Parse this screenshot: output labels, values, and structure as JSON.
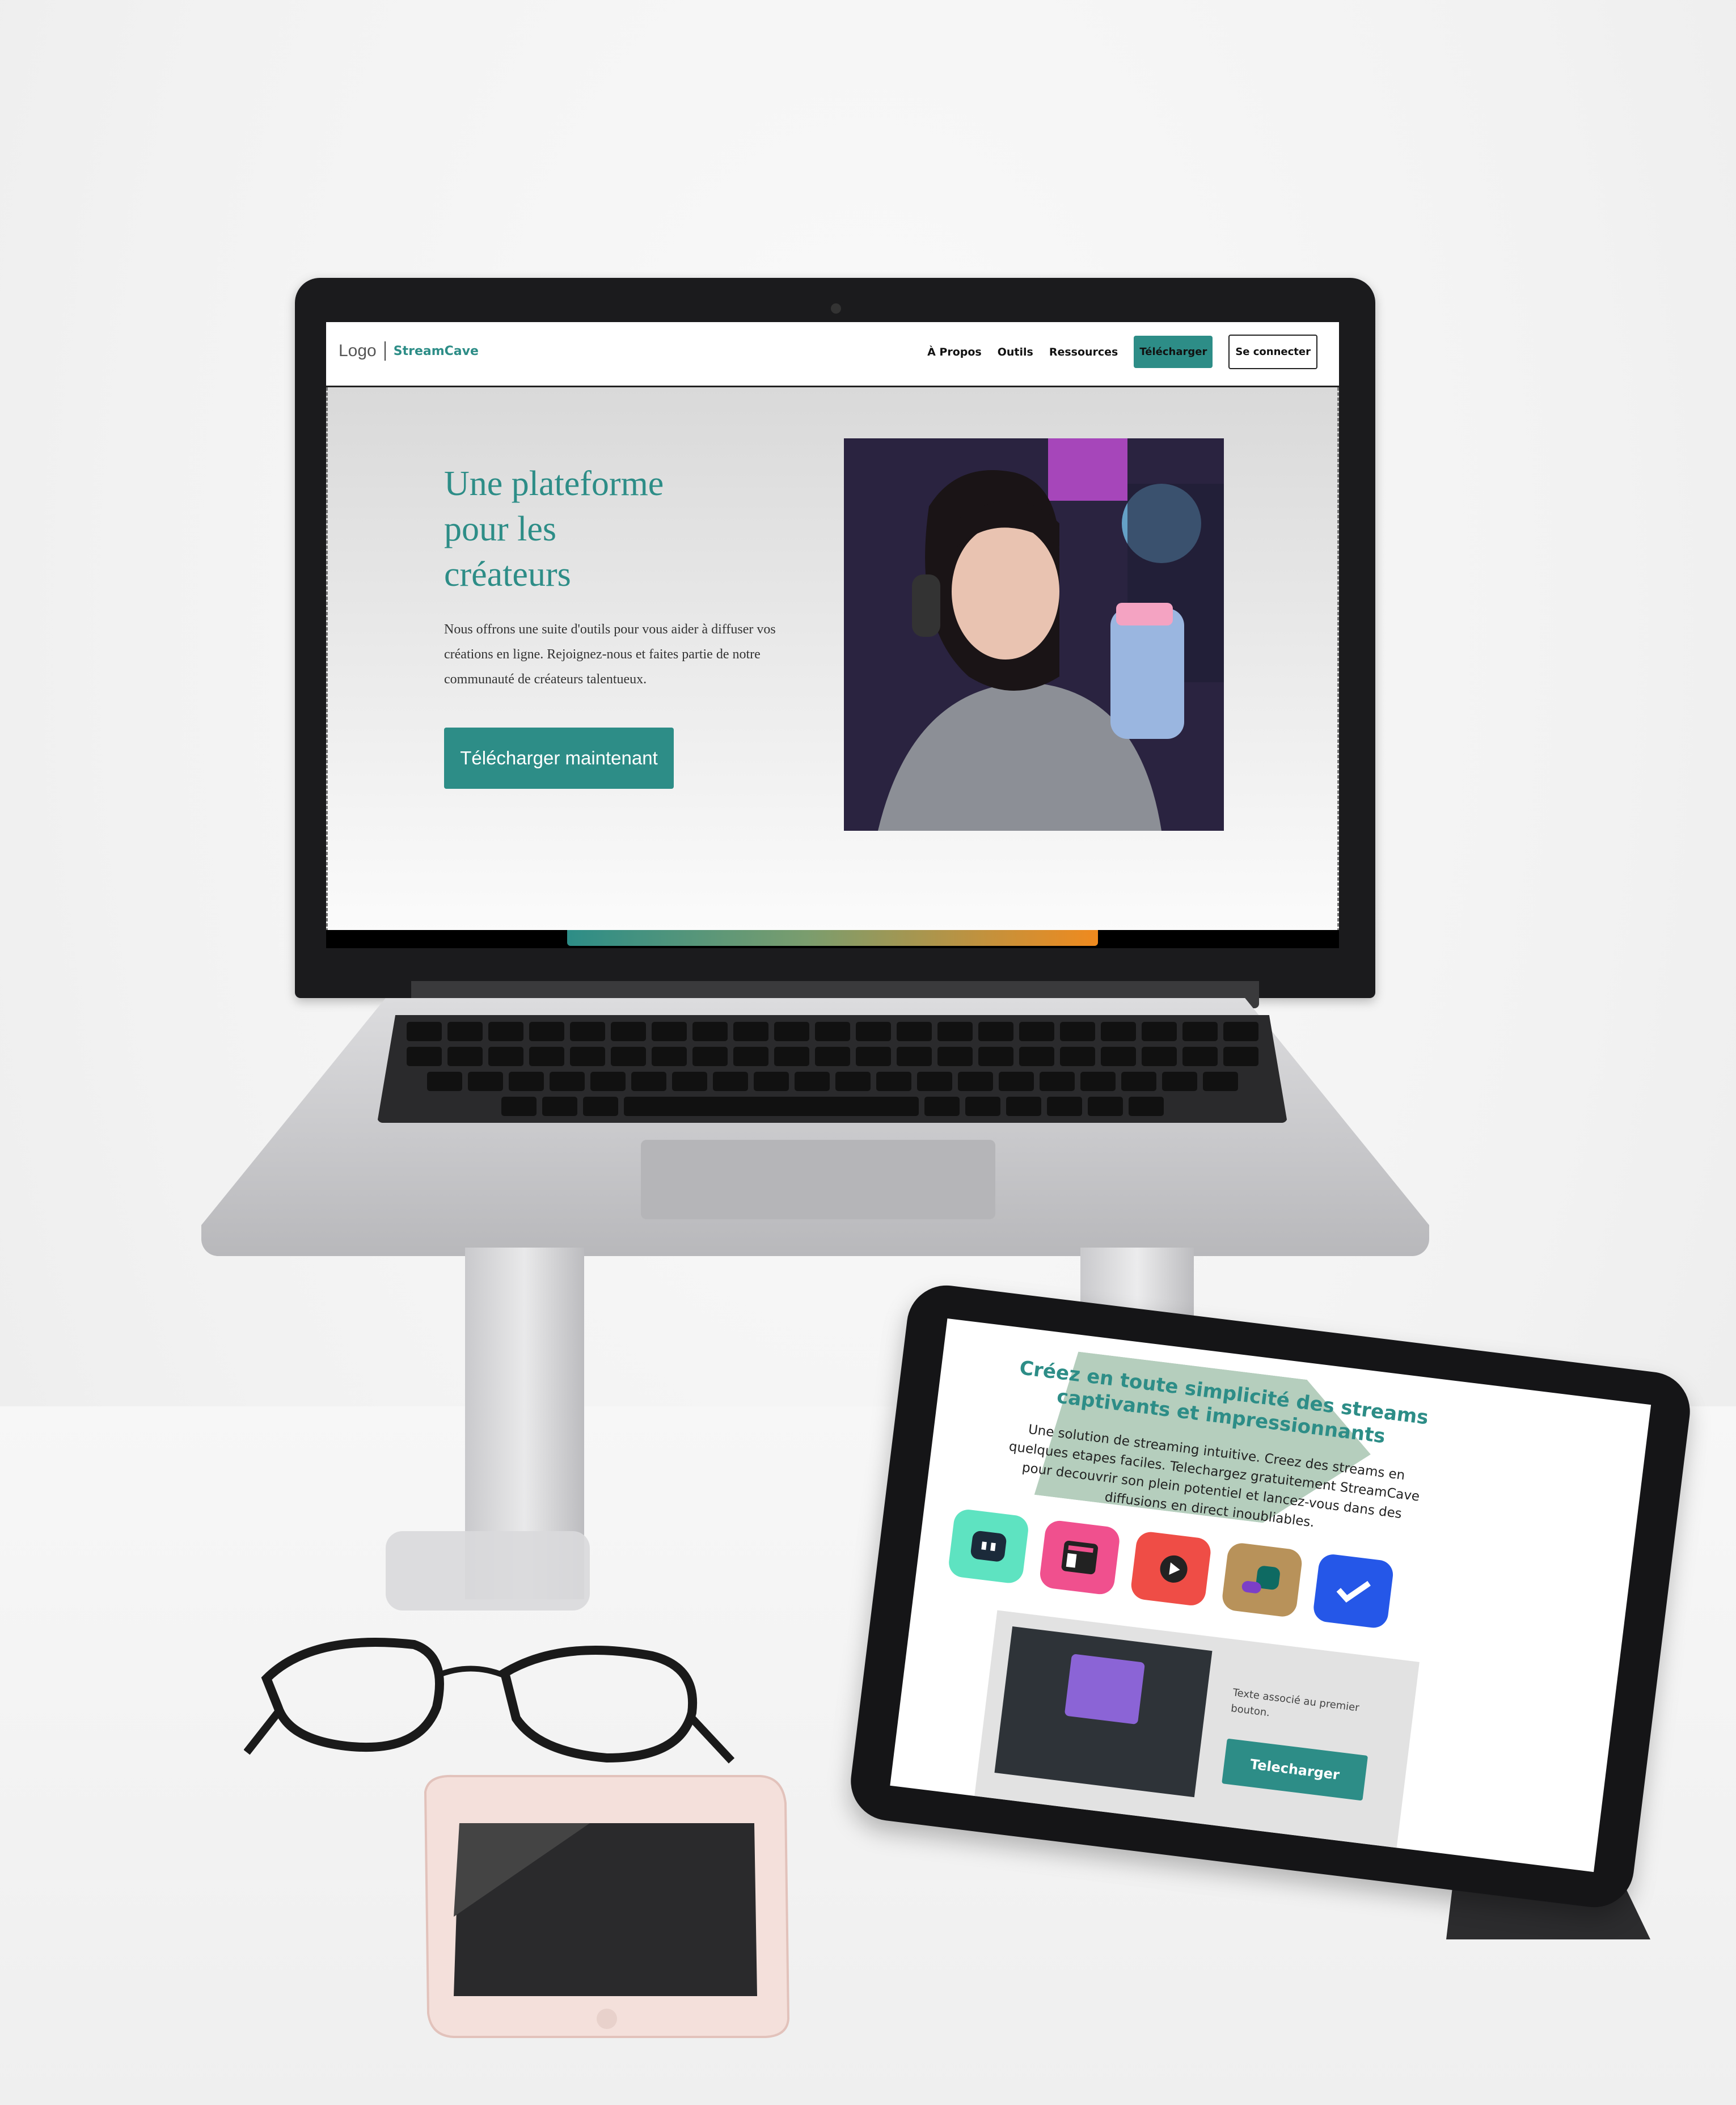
{
  "website": {
    "nav": {
      "logo_alt": "Logo",
      "brand": "StreamCave",
      "links": [
        "À Propos",
        "Outils",
        "Ressources"
      ],
      "download_button": "Télécharger",
      "login_button": "Se connecter"
    },
    "hero": {
      "title_lines": [
        "Une plateforme",
        "pour les",
        "créateurs"
      ],
      "description": "Nous offrons une suite d'outils pour vous aider à diffuser vos créations en ligne. Rejoignez-nous et faites partie de notre communauté de créateurs talentueux.",
      "cta": "Télécharger maintenant"
    }
  },
  "tablet": {
    "title": "Créez en toute simplicité des streams captivants et impressionnants",
    "description": "Une solution de streaming intuitive. Creez des streams en quelques etapes faciles. Telechargez gratuitement StreamCave pour decouvrir son plein potentiel et lancez-vous dans des diffusions en direct inoubliables.",
    "apps": [
      {
        "name": "app-icon-mint",
        "color": "#5ee3c1"
      },
      {
        "name": "app-icon-pink",
        "color": "#f0508e"
      },
      {
        "name": "app-icon-red",
        "color": "#ef4d46"
      },
      {
        "name": "app-icon-gold",
        "color": "#b8925a"
      },
      {
        "name": "app-icon-blue",
        "color": "#2557e8"
      }
    ],
    "card_text": "Texte associé au premier bouton.",
    "card_button": "Telecharger"
  },
  "colors": {
    "accent": "#2d8d87",
    "orange": "#f08a1e"
  }
}
